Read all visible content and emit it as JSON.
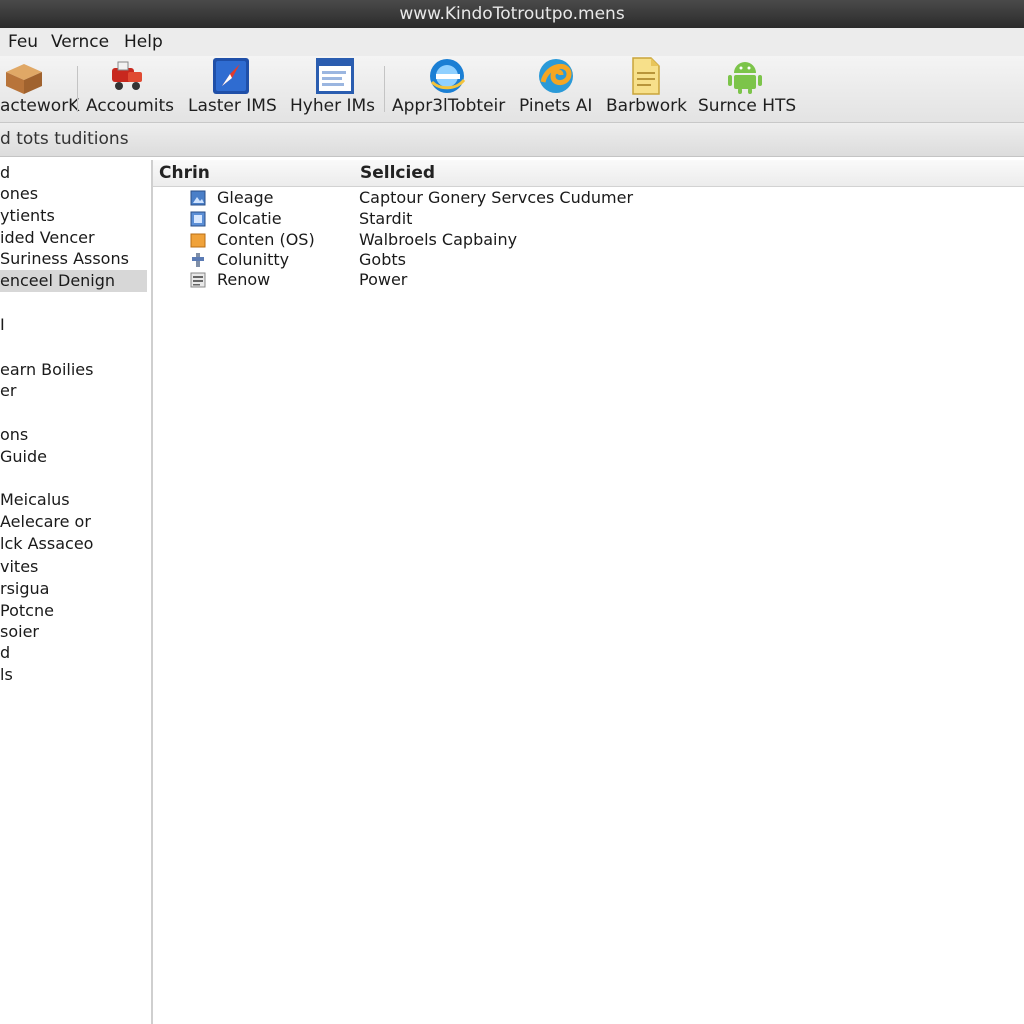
{
  "window": {
    "title": "www.KindoTotroutpo.mens"
  },
  "menubar": {
    "items": [
      "Feu",
      "Vernce",
      "Help"
    ]
  },
  "toolbar": {
    "buttons": [
      {
        "label": "acteworK",
        "icon": "box-icon"
      },
      {
        "label": "Accoumits",
        "icon": "truck-icon"
      },
      {
        "label": "Laster IMS",
        "icon": "compass-icon"
      },
      {
        "label": "Hyher IMs",
        "icon": "window-icon"
      },
      {
        "label": "Appr3lTobteir",
        "icon": "globe-icon"
      },
      {
        "label": "Pinets AI",
        "icon": "swirl-icon"
      },
      {
        "label": "Barbwork",
        "icon": "document-icon"
      },
      {
        "label": "Surnce HTS",
        "icon": "android-icon"
      }
    ]
  },
  "address": {
    "text": "d tots tuditions"
  },
  "sidebar": {
    "items": [
      {
        "label": "d"
      },
      {
        "label": "ones"
      },
      {
        "label": "ytients"
      },
      {
        "label": "ided Vencer"
      },
      {
        "label": "Suriness Assons"
      },
      {
        "label": "enceel Denign",
        "selected": true
      },
      {
        "label": "I"
      },
      {
        "label": "earn Boilies"
      },
      {
        "label": "er"
      },
      {
        "label": "ons"
      },
      {
        "label": "Guide"
      },
      {
        "label": "Meicalus"
      },
      {
        "label": "Aelecare or"
      },
      {
        "label": "lck Assaceo"
      },
      {
        "label": "vites"
      },
      {
        "label": "rsigua"
      },
      {
        "label": "Potcne"
      },
      {
        "label": "soier"
      },
      {
        "label": "d"
      },
      {
        "label": "ls"
      }
    ]
  },
  "table": {
    "columns": [
      "Chrin",
      "Sellcied"
    ],
    "rows": [
      {
        "name": "Gleage",
        "selected": "Captour Gonery Servces Cudumer",
        "icon": "image-icon"
      },
      {
        "name": "Colcatie",
        "selected": "Stardit",
        "icon": "image-icon"
      },
      {
        "name": "Conten (OS)",
        "selected": "Walbroels Capbainy",
        "icon": "folder-icon"
      },
      {
        "name": "Colunitty",
        "selected": "Gobts",
        "icon": "tool-icon"
      },
      {
        "name": "Renow",
        "selected": "Power",
        "icon": "list-icon"
      }
    ]
  }
}
